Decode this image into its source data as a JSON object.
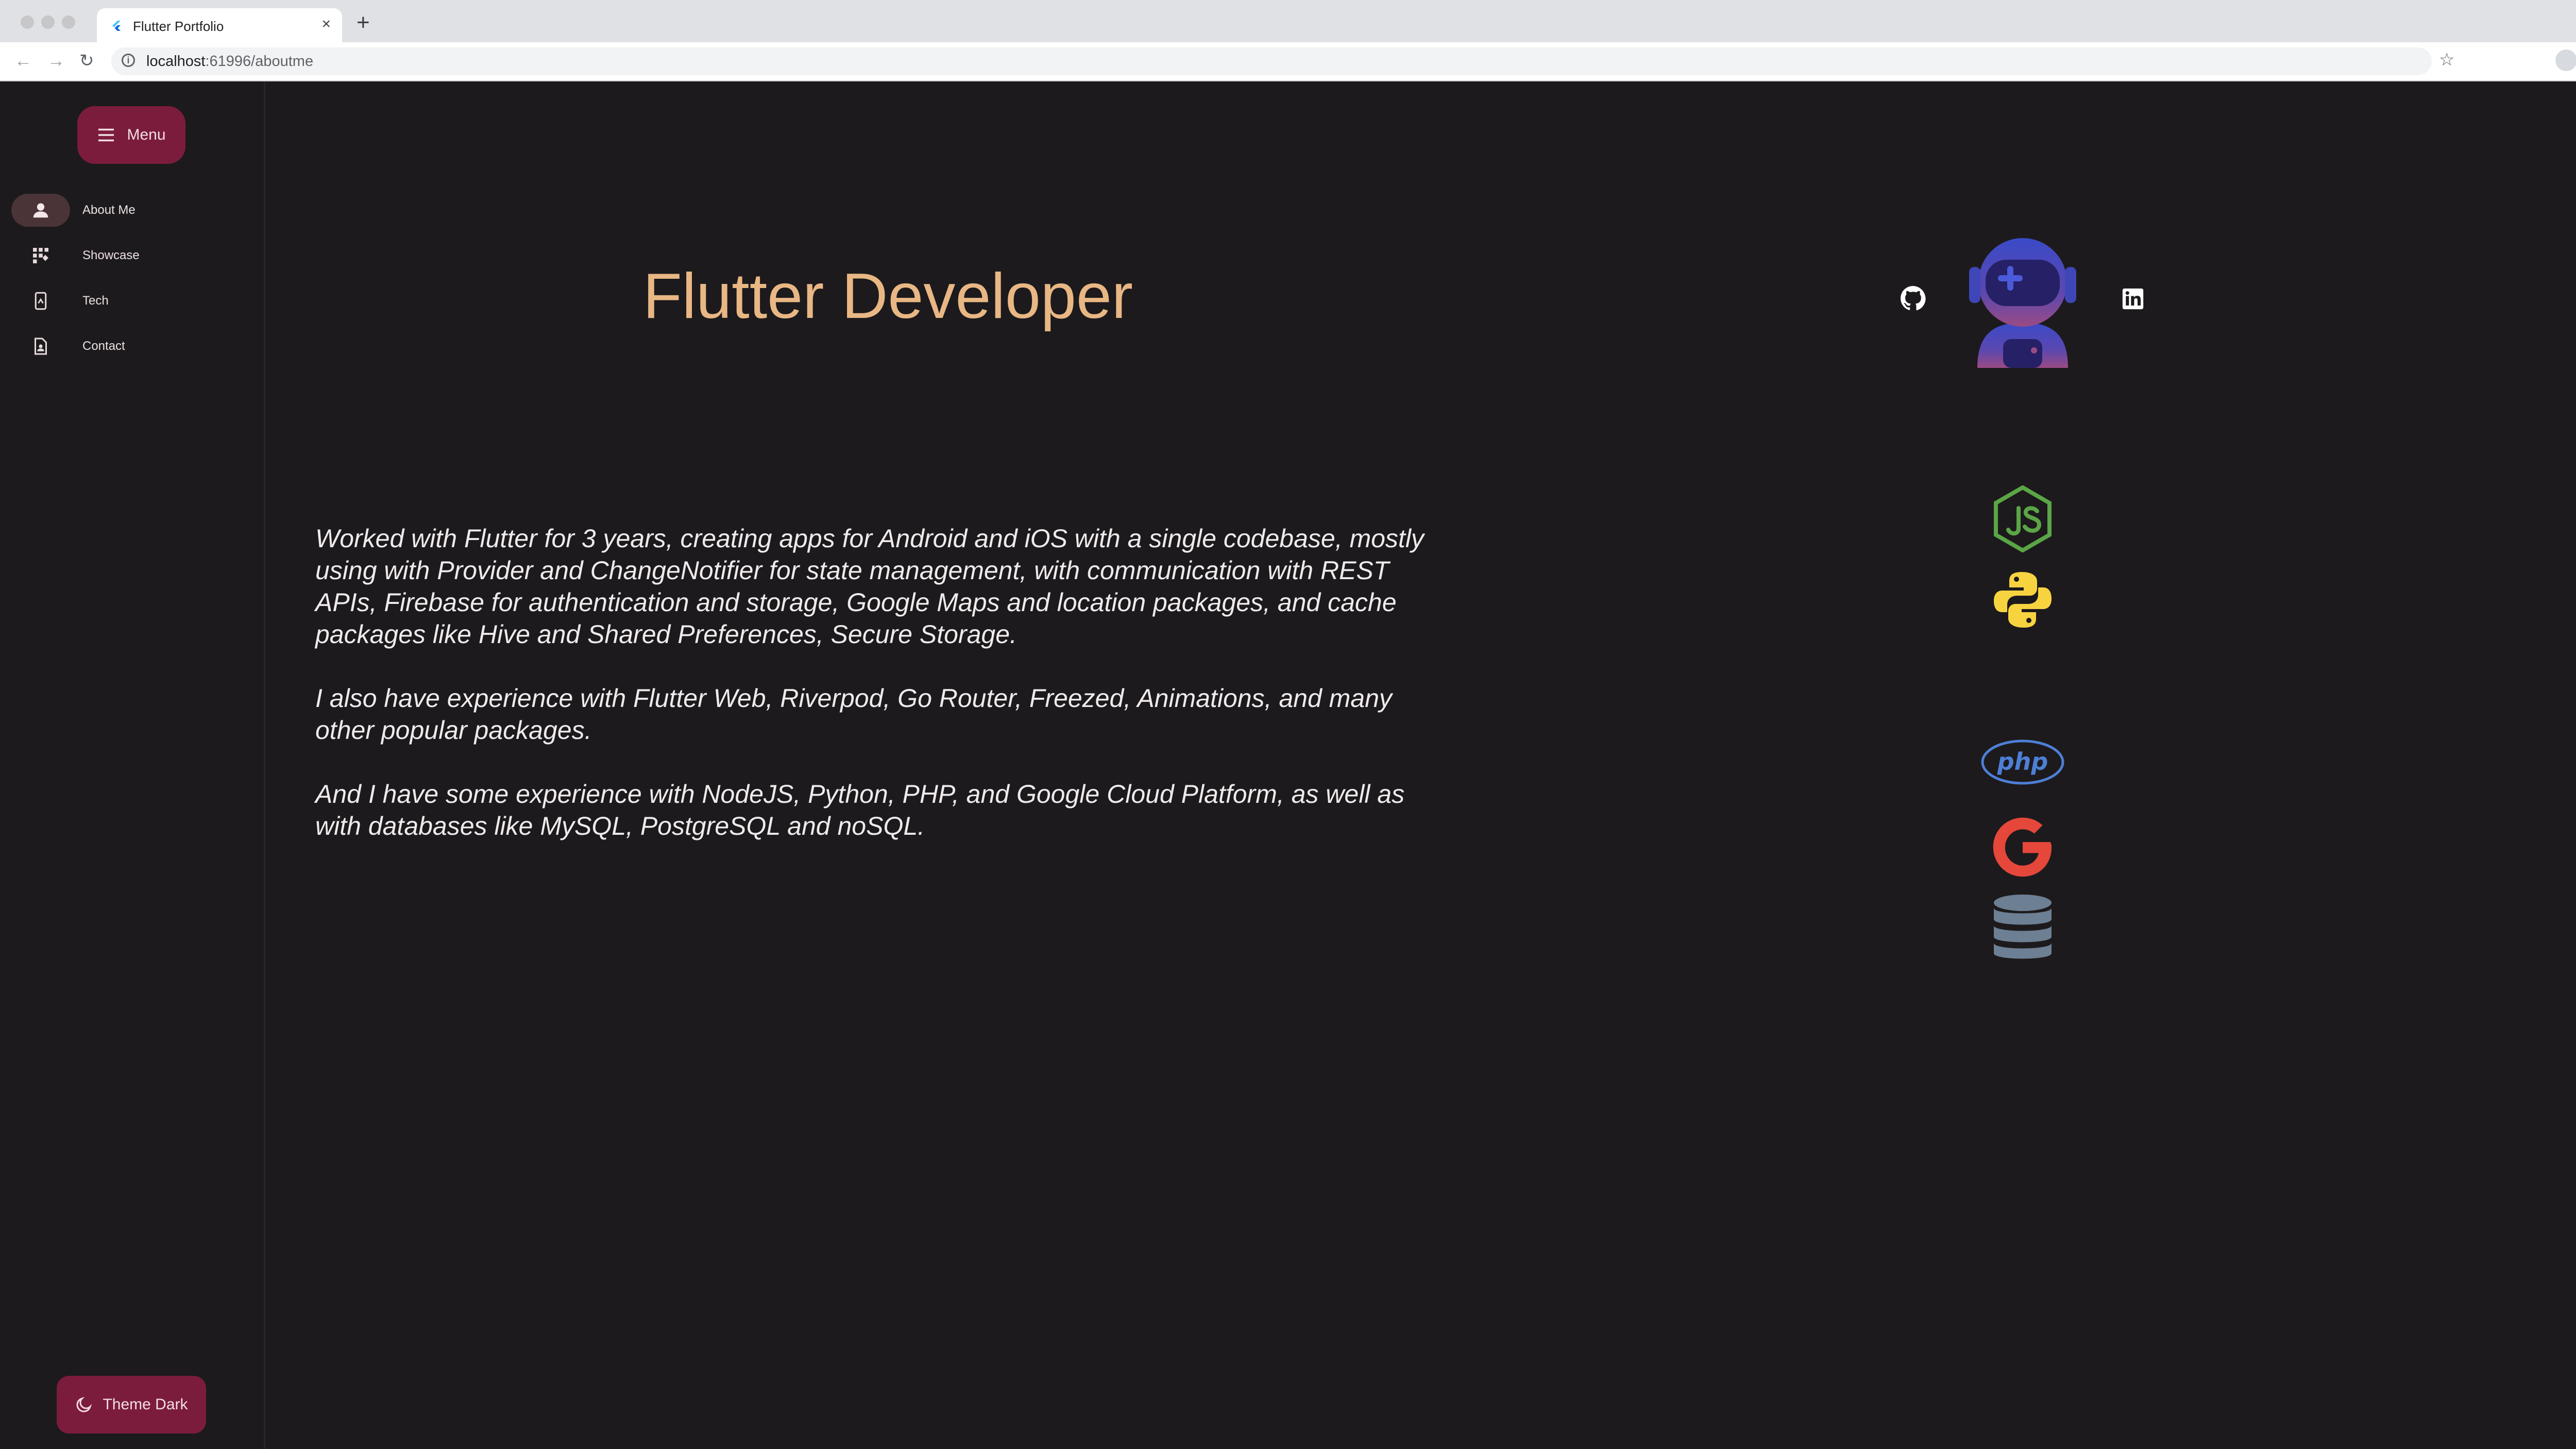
{
  "browser": {
    "tab_title": "Flutter Portfolio",
    "url_host": "localhost",
    "url_path": ":61996/aboutme",
    "icons": [
      "back-arrow-icon",
      "forward-arrow-icon",
      "reload-icon",
      "info-icon",
      "share-icon",
      "star-icon",
      "side-panel-icon",
      "profile-icon",
      "more-icon"
    ]
  },
  "app": {
    "menu_label": "Menu",
    "nav": [
      {
        "label": "About Me",
        "icon": "person-icon",
        "active": true
      },
      {
        "label": "Showcase",
        "icon": "apps-grid-icon",
        "active": false
      },
      {
        "label": "Tech",
        "icon": "phone-device-icon",
        "active": false
      },
      {
        "label": "Contact",
        "icon": "contact-page-icon",
        "active": false
      }
    ],
    "theme_label": "Theme Dark",
    "title": "Flutter Developer",
    "paragraphs": [
      "Worked with Flutter for 3 years, creating apps for Android and iOS with a single codebase, mostly using with Provider and ChangeNotifier for state management, with communication with REST APIs, Firebase for authentication and storage,  Google Maps and location packages, and cache packages like Hive and Shared Preferences, Secure Storage.",
      "I also have experience with Flutter Web, Riverpod, Go Router, Freezed, Animations, and many other popular packages.",
      "And I have some experience with NodeJS, Python, PHP, and Google Cloud Platform, as well as with databases like MySQL, PostgreSQL and noSQL."
    ],
    "social_icons": [
      "github-icon",
      "astronaut-avatar-icon",
      "linkedin-icon"
    ],
    "tech_icons": [
      "nodejs-icon",
      "python-icon",
      "php-icon",
      "google-icon",
      "database-icon"
    ],
    "php_logo_text": "php",
    "colors": {
      "accent": "#7c1c3c",
      "title": "#e8b784",
      "background": "#1c1a1c",
      "text": "#f0eaec"
    }
  }
}
